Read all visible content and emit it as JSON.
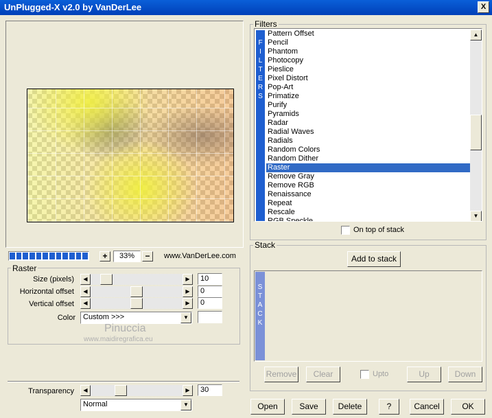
{
  "window": {
    "title": "UnPlugged-X v2.0 by VanDerLee",
    "close": "X"
  },
  "zoom": {
    "value": "33%",
    "plus": "+",
    "minus": "−",
    "site": "www.VanDerLee.com"
  },
  "progress": {
    "segments": 12
  },
  "raster": {
    "group_label": "Raster",
    "size": {
      "label": "Size (pixels)",
      "value": "10",
      "level": 0.12
    },
    "hoffset": {
      "label": "Horizontal offset",
      "value": "0",
      "level": 0.5
    },
    "voffset": {
      "label": "Vertical offset",
      "value": "0",
      "level": 0.5
    },
    "color": {
      "label": "Color",
      "value": "Custom >>>",
      "swatch": "#ffffff"
    }
  },
  "watermark": {
    "name": "Pinuccia",
    "site": "www.maidiregrafica.eu"
  },
  "transparency": {
    "label": "Transparency",
    "value": "30",
    "level": 0.3
  },
  "blend": {
    "value": "Normal"
  },
  "filters": {
    "group_label": "Filters",
    "strip": [
      "F",
      "I",
      "L",
      "T",
      "E",
      "R",
      "S"
    ],
    "items": [
      "Pattern Offset",
      "Pencil",
      "Phantom",
      "Photocopy",
      "Pieslice",
      "Pixel Distort",
      "Pop-Art",
      "Primatize",
      "Purify",
      "Pyramids",
      "Radar",
      "Radial Waves",
      "Radials",
      "Random Colors",
      "Random Dither",
      "Raster",
      "Remove Gray",
      "Remove RGB",
      "Renaissance",
      "Repeat",
      "Rescale",
      "RGB Speckle"
    ],
    "selected": "Raster",
    "on_top_label": "On top of stack"
  },
  "stack": {
    "group_label": "Stack",
    "add_label": "Add to stack",
    "strip": [
      "S",
      "T",
      "A",
      "C",
      "K"
    ],
    "remove": "Remove",
    "clear": "Clear",
    "upto": "Upto",
    "up": "Up",
    "down": "Down"
  },
  "footer": {
    "open": "Open",
    "save": "Save",
    "delete": "Delete",
    "help": "?",
    "cancel": "Cancel",
    "ok": "OK"
  },
  "colors": {
    "titlebar": "#0a5fd8",
    "selection": "#316ac5",
    "strip": "#1f5fd0"
  }
}
